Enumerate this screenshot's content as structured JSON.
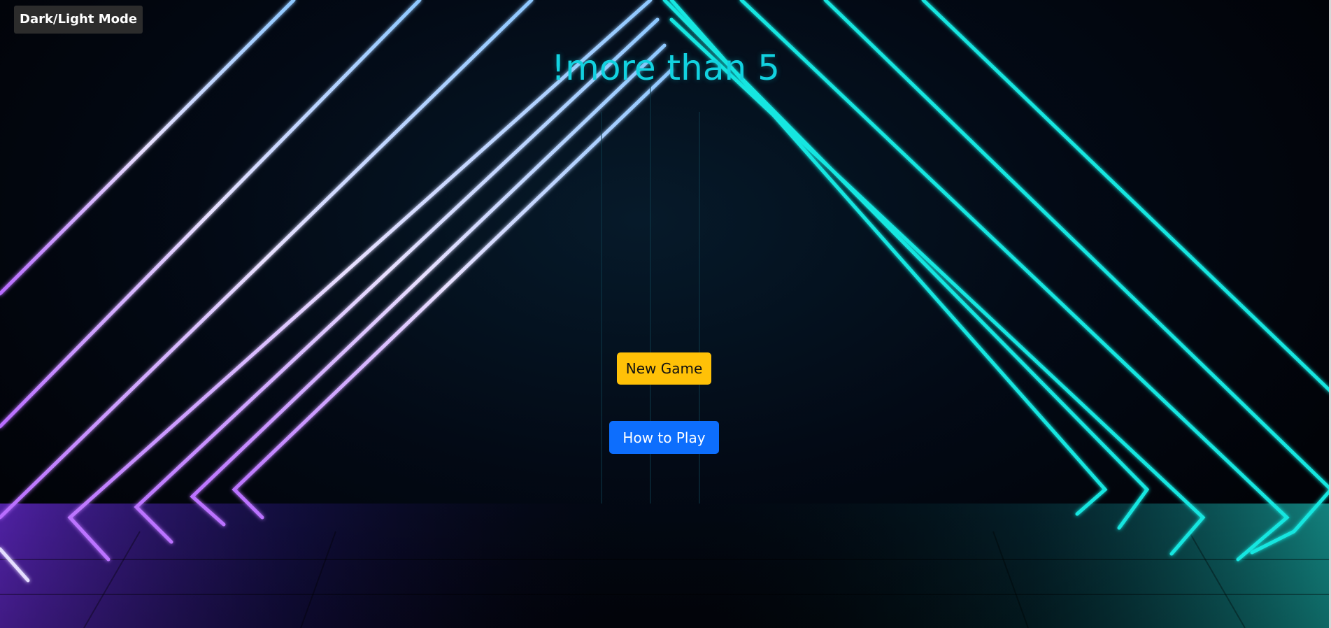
{
  "toolbar": {
    "mode_toggle_label": "Dark/Light Mode"
  },
  "main": {
    "title": "!more than 5",
    "new_game_label": "New Game",
    "how_to_play_label": "How to Play"
  },
  "colors": {
    "title": "#12d2e0",
    "new_game_bg": "#ffc107",
    "how_to_play_bg": "#0d6efd",
    "toggle_bg": "#2c2c2c",
    "neon_left": "#c9b4ff",
    "neon_right": "#18e6e0"
  },
  "background": {
    "description_icon": "neon-triangle-tunnel-icon"
  }
}
